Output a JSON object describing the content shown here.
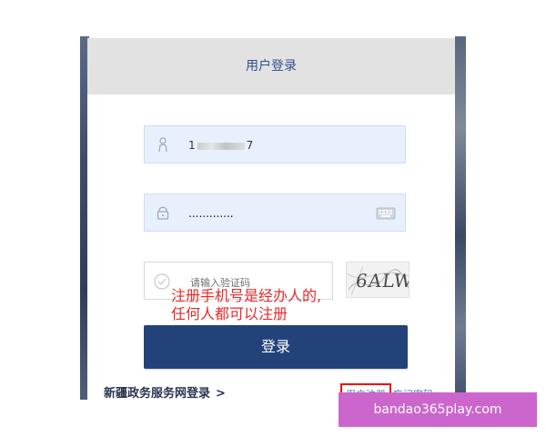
{
  "header": {
    "title": "用户登录"
  },
  "form": {
    "username": {
      "value_prefix": "1",
      "value_suffix": "7",
      "icon": "person-icon"
    },
    "password": {
      "masked_value": ".............",
      "icon": "lock-icon",
      "right_icon": "keyboard-icon"
    },
    "captcha": {
      "placeholder": "请输入验证码",
      "icon": "check-circle-icon",
      "image_text": "6ALW"
    }
  },
  "annotation": {
    "line1": "注册手机号是经办人的,",
    "line2": "任何人都可以注册"
  },
  "login_button": {
    "label": "登录"
  },
  "footer": {
    "left_link": "新疆政务服务网登录",
    "left_chevron": ">",
    "register": "用户注册",
    "forgot": "忘记密码"
  },
  "watermark": "bandao365play.com",
  "colors": {
    "primary": "#23427a",
    "accent": "#e32b2b",
    "header_bg": "#e2e2e2",
    "input_bg": "#e8f0fe"
  }
}
